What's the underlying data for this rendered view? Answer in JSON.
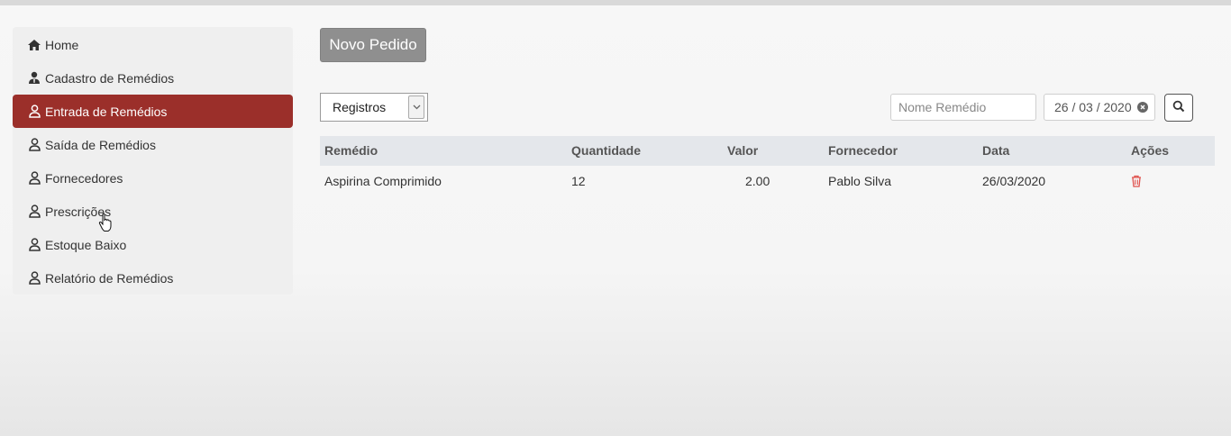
{
  "sidebar": {
    "items": [
      {
        "label": "Home",
        "icon": "home-icon"
      },
      {
        "label": "Cadastro de Remédios",
        "icon": "user-tie-icon"
      },
      {
        "label": "Entrada de Remédios",
        "icon": "user-icon",
        "active": true
      },
      {
        "label": "Saída de Remédios",
        "icon": "user-icon"
      },
      {
        "label": "Fornecedores",
        "icon": "user-icon"
      },
      {
        "label": "Prescrições",
        "icon": "user-icon"
      },
      {
        "label": "Estoque Baixo",
        "icon": "user-icon"
      },
      {
        "label": "Relatório de Remédios",
        "icon": "user-icon"
      }
    ]
  },
  "toolbar": {
    "new_order_label": "Novo Pedido",
    "filter_select_value": "Registros",
    "search_placeholder": "Nome Remédio",
    "date_value": "26 / 03 / 2020"
  },
  "table": {
    "headers": [
      "Remédio",
      "Quantidade",
      "Valor",
      "Fornecedor",
      "Data",
      "Ações"
    ],
    "rows": [
      {
        "remedio": "Aspirina Comprimido",
        "quantidade": "12",
        "valor": "2.00",
        "fornecedor": "Pablo Silva",
        "data": "26/03/2020"
      }
    ]
  },
  "colors": {
    "active_nav": "#9b2f2a",
    "primary_button": "#8f8f8f",
    "delete_icon": "#e0524e"
  }
}
